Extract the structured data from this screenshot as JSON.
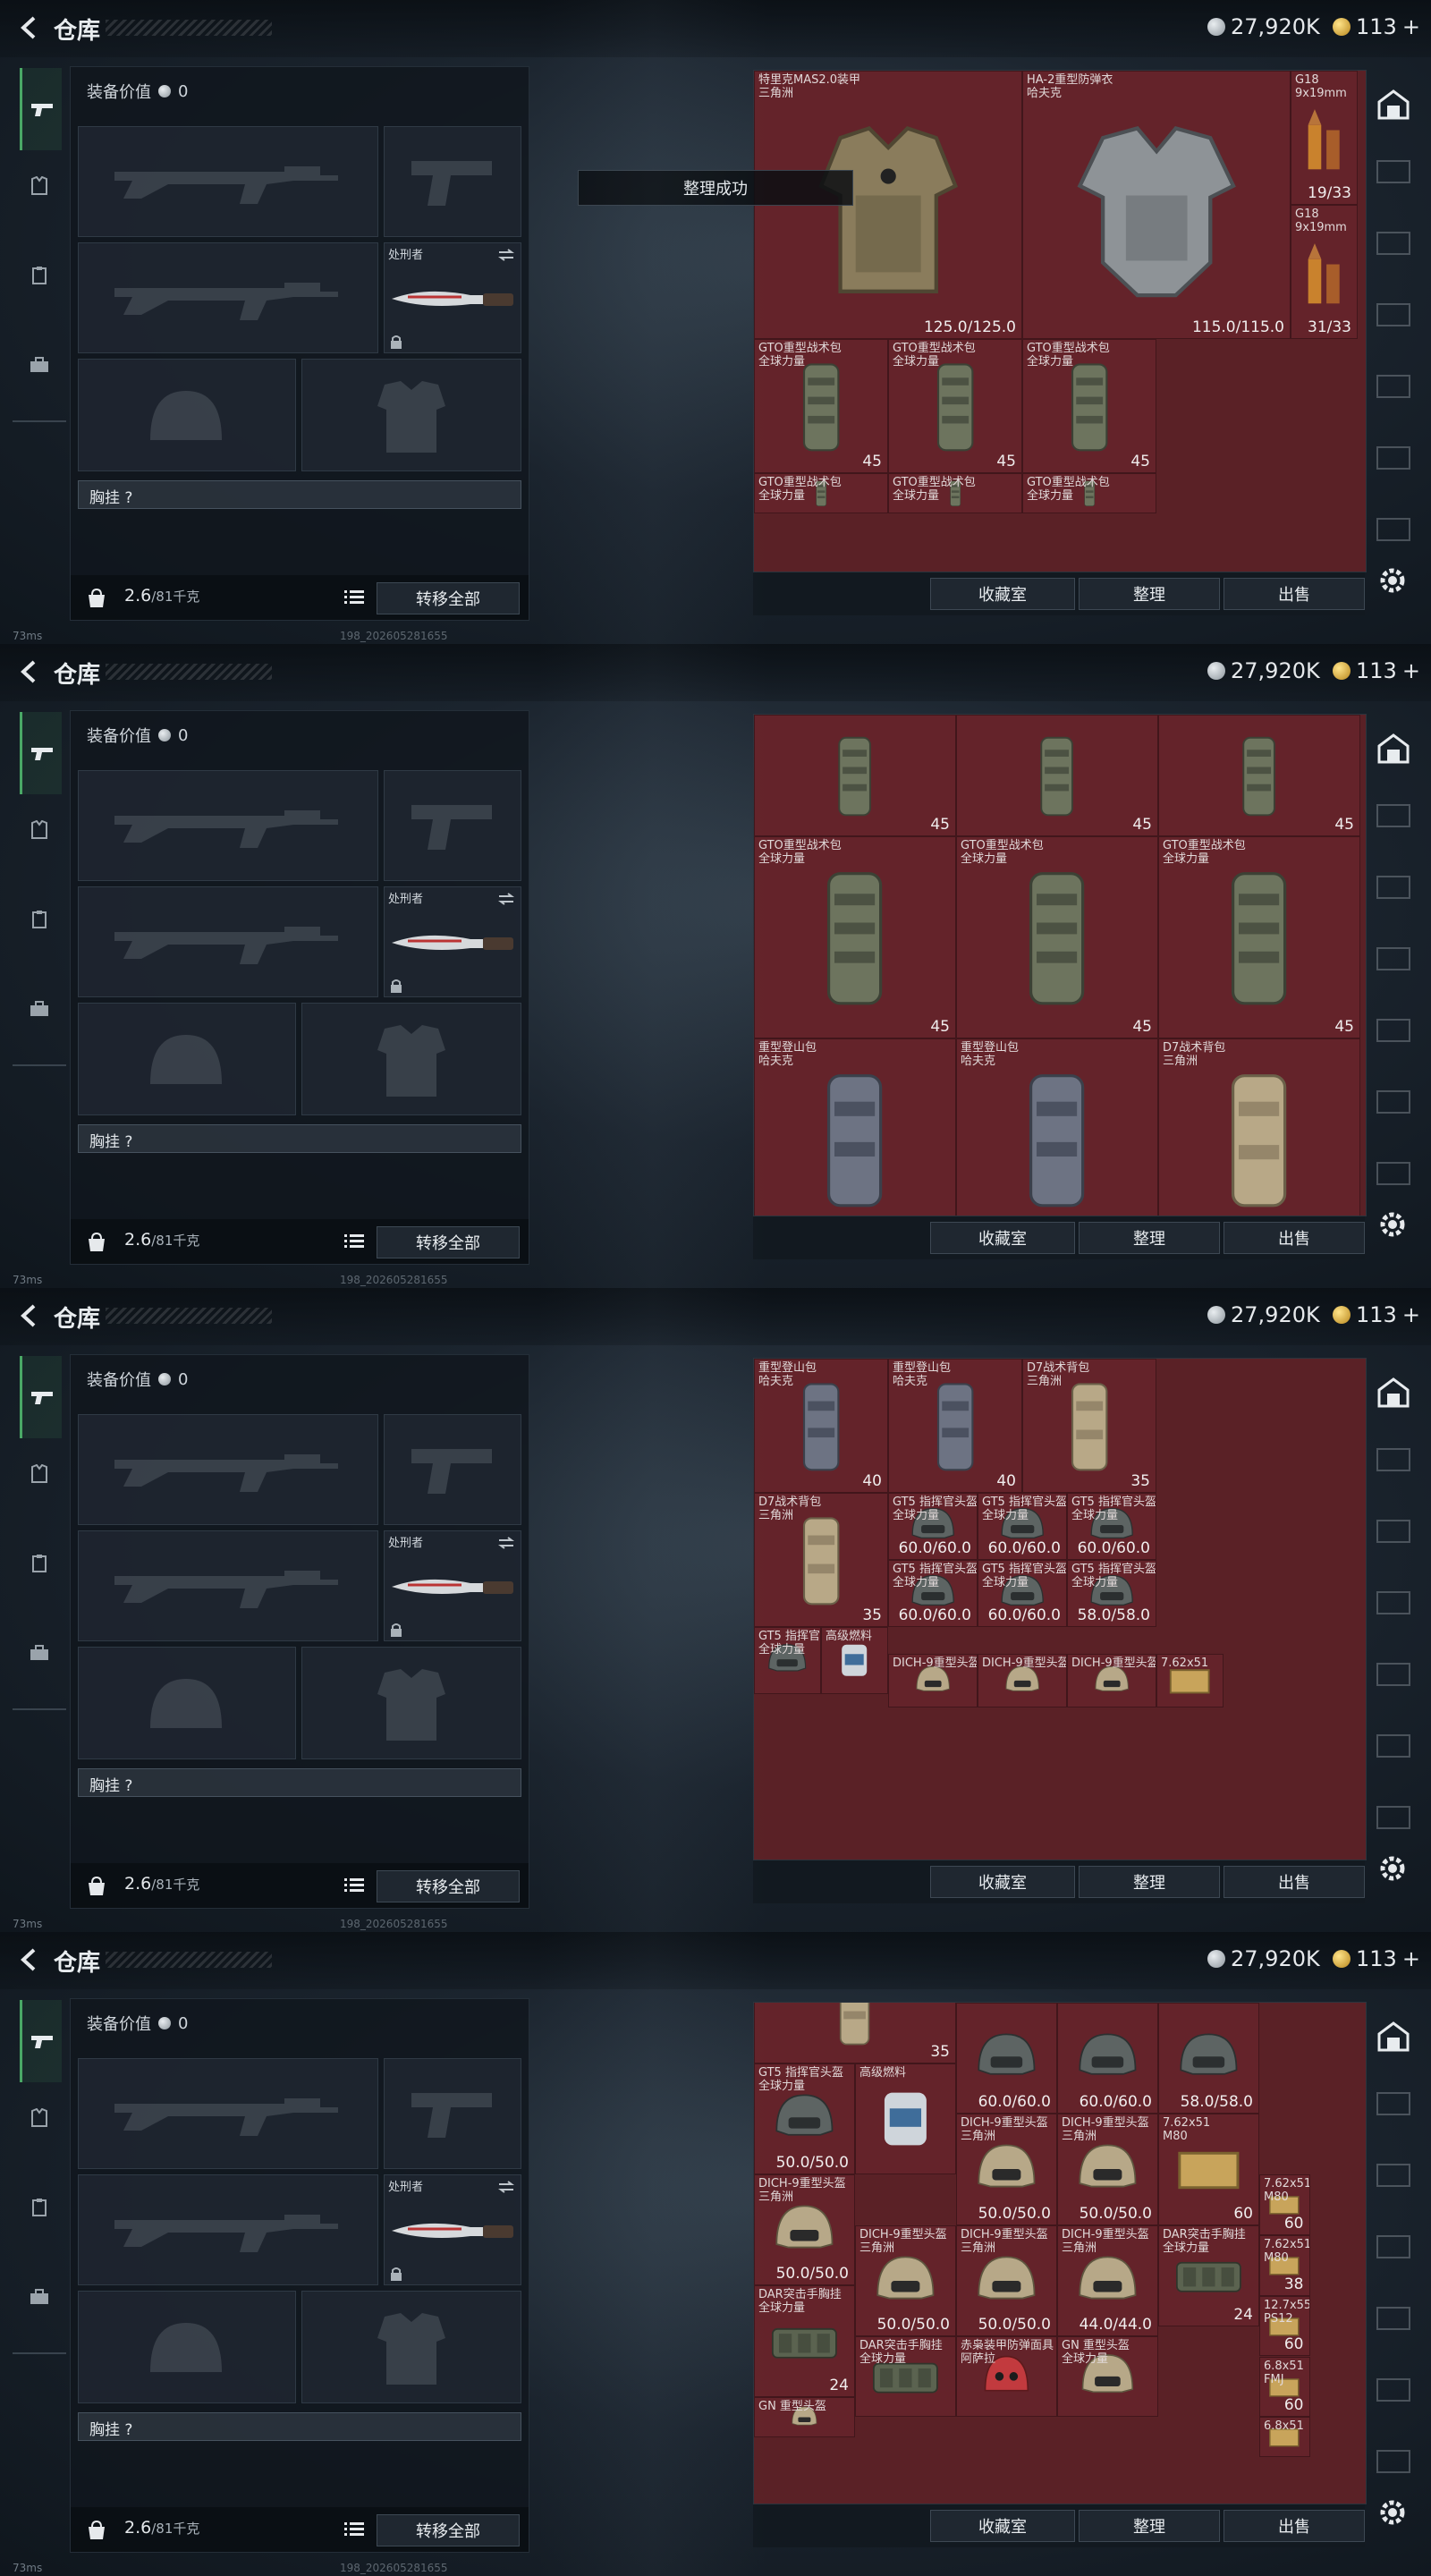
{
  "app": {
    "title": "仓库"
  },
  "currency": {
    "silver": "27,920K",
    "gold": "113",
    "gold_plus": "+"
  },
  "loadout": {
    "value_label": "装备价值",
    "value": "0",
    "melee_name": "处刑者",
    "chest_label": "胸挂 ?",
    "weight": "2.6",
    "weight_max": "/81千克",
    "transfer_all": "转移全部"
  },
  "stash_buttons": {
    "collection": "收藏室",
    "sort": "整理",
    "sell": "出售"
  },
  "toast": "整理成功",
  "status": {
    "ping": "73ms",
    "build": "198_202605281655"
  },
  "frames": [
    {
      "cells": [
        {
          "name": "特里克MAS2.0装甲\n三角洲",
          "value": "125.0/125.0",
          "kind": "vest-camo"
        },
        {
          "name": "HA-2重型防弹衣\n哈夫克",
          "value": "115.0/115.0",
          "kind": "vest-grey"
        },
        {
          "name": "G18\n9x19mm",
          "value": "19/33",
          "kind": "ammo"
        },
        {
          "name": "G18\n9x19mm",
          "value": "31/33",
          "kind": "ammo"
        },
        {
          "name": "GTO重型战术包\n全球力量",
          "value": "45",
          "kind": "pack-green"
        },
        {
          "name": "GTO重型战术包\n全球力量",
          "value": "45",
          "kind": "pack-green"
        },
        {
          "name": "GTO重型战术包\n全球力量",
          "value": "45",
          "kind": "pack-green"
        },
        {
          "name": "GTO重型战术包\n全球力量",
          "value": "",
          "kind": "pack-green"
        },
        {
          "name": "GTO重型战术包\n全球力量",
          "value": "",
          "kind": "pack-green"
        },
        {
          "name": "GTO重型战术包\n全球力量",
          "value": "",
          "kind": "pack-green"
        }
      ]
    },
    {
      "cells": [
        {
          "name": "",
          "value": "45",
          "kind": "pack-green"
        },
        {
          "name": "",
          "value": "45",
          "kind": "pack-green"
        },
        {
          "name": "",
          "value": "45",
          "kind": "pack-green"
        },
        {
          "name": "GTO重型战术包\n全球力量",
          "value": "45",
          "kind": "pack-green"
        },
        {
          "name": "GTO重型战术包\n全球力量",
          "value": "45",
          "kind": "pack-green"
        },
        {
          "name": "GTO重型战术包\n全球力量",
          "value": "45",
          "kind": "pack-green"
        },
        {
          "name": "重型登山包\n哈夫克",
          "value": "",
          "kind": "pack-blue"
        },
        {
          "name": "重型登山包\n哈夫克",
          "value": "",
          "kind": "pack-blue"
        },
        {
          "name": "D7战术背包\n三角洲",
          "value": "",
          "kind": "pack-tan"
        }
      ]
    },
    {
      "cells": [
        {
          "name": "重型登山包\n哈夫克",
          "value": "40",
          "kind": "pack-blue"
        },
        {
          "name": "重型登山包\n哈夫克",
          "value": "40",
          "kind": "pack-blue"
        },
        {
          "name": "D7战术背包\n三角洲",
          "value": "35",
          "kind": "pack-tan"
        },
        {
          "name": "D7战术背包\n三角洲",
          "value": "35",
          "kind": "pack-tan"
        },
        {
          "name": "GT5 指挥官头盔\n全球力量",
          "value": "60.0/60.0",
          "kind": "helmet-dark"
        },
        {
          "name": "GT5 指挥官头盔\n全球力量",
          "value": "60.0/60.0",
          "kind": "helmet-dark"
        },
        {
          "name": "GT5 指挥官头盔\n全球力量",
          "value": "60.0/60.0",
          "kind": "helmet-dark"
        },
        {
          "name": "GT5 指挥官头盔\n全球力量",
          "value": "60.0/60.0",
          "kind": "helmet-dark"
        },
        {
          "name": "GT5 指挥官头盔\n全球力量",
          "value": "60.0/60.0",
          "kind": "helmet-dark"
        },
        {
          "name": "GT5 指挥官头盔\n全球力量",
          "value": "58.0/58.0",
          "kind": "helmet-dark"
        },
        {
          "name": "GT5 指挥官头盔\n全球力量",
          "value": "",
          "kind": "helmet-dark"
        },
        {
          "name": "高级燃料",
          "value": "",
          "kind": "fuel"
        },
        {
          "name": "DICH-9重型头盔",
          "value": "",
          "kind": "helmet-tan"
        },
        {
          "name": "DICH-9重型头盔",
          "value": "",
          "kind": "helmet-tan"
        },
        {
          "name": "DICH-9重型头盔",
          "value": "",
          "kind": "helmet-tan"
        },
        {
          "name": "7.62x51",
          "value": "",
          "kind": "ammo-box"
        }
      ]
    },
    {
      "cells": [
        {
          "name": "",
          "value": "35",
          "kind": "pack-tan"
        },
        {
          "name": "",
          "value": "60.0/60.0",
          "kind": "helmet-dark"
        },
        {
          "name": "",
          "value": "60.0/60.0",
          "kind": "helmet-dark"
        },
        {
          "name": "",
          "value": "58.0/58.0",
          "kind": "helmet-dark"
        },
        {
          "name": "GT5 指挥官头盔\n全球力量",
          "value": "50.0/50.0",
          "kind": "helmet-dark"
        },
        {
          "name": "高级燃料",
          "value": "",
          "kind": "fuel"
        },
        {
          "name": "DICH-9重型头盔\n三角洲",
          "value": "50.0/50.0",
          "kind": "helmet-tan"
        },
        {
          "name": "DICH-9重型头盔\n三角洲",
          "value": "50.0/50.0",
          "kind": "helmet-tan"
        },
        {
          "name": "DICH-9重型头盔\n三角洲",
          "value": "50.0/50.0",
          "kind": "helmet-tan"
        },
        {
          "name": "7.62x51\nM80",
          "value": "60",
          "kind": "ammo-box"
        },
        {
          "name": "DICH-9重型头盔\n三角洲",
          "value": "50.0/50.0",
          "kind": "helmet-tan"
        },
        {
          "name": "7.62x51\nM80",
          "value": "60",
          "kind": "ammo-box"
        },
        {
          "name": "DICH-9重型头盔\n三角洲",
          "value": "50.0/50.0",
          "kind": "helmet-tan"
        },
        {
          "name": "DICH-9重型头盔\n三角洲",
          "value": "44.0/44.0",
          "kind": "helmet-tan"
        },
        {
          "name": "DAR突击手胸挂\n全球力量",
          "value": "24",
          "kind": "rig"
        },
        {
          "name": "7.62x51\nM80",
          "value": "38",
          "kind": "ammo-box"
        },
        {
          "name": "DAR突击手胸挂\n全球力量",
          "value": "24",
          "kind": "rig"
        },
        {
          "name": "12.7x55\nPS12",
          "value": "60",
          "kind": "ammo-box"
        },
        {
          "name": "DAR突击手胸挂\n全球力量",
          "value": "",
          "kind": "rig"
        },
        {
          "name": "赤枭装甲防弹面具\n阿萨拉",
          "value": "",
          "kind": "helmet-red"
        },
        {
          "name": "GN 重型头盔\n全球力量",
          "value": "",
          "kind": "helmet-tan"
        },
        {
          "name": "6.8x51\nFMJ",
          "value": "60",
          "kind": "ammo-box"
        },
        {
          "name": "GN 重型头盔",
          "value": "",
          "kind": "helmet-tan"
        },
        {
          "name": "6.8x51",
          "value": "",
          "kind": "ammo-box"
        }
      ]
    }
  ],
  "colors": {
    "stash_bg": "#5a2126",
    "active_tab": "#4aa866"
  }
}
